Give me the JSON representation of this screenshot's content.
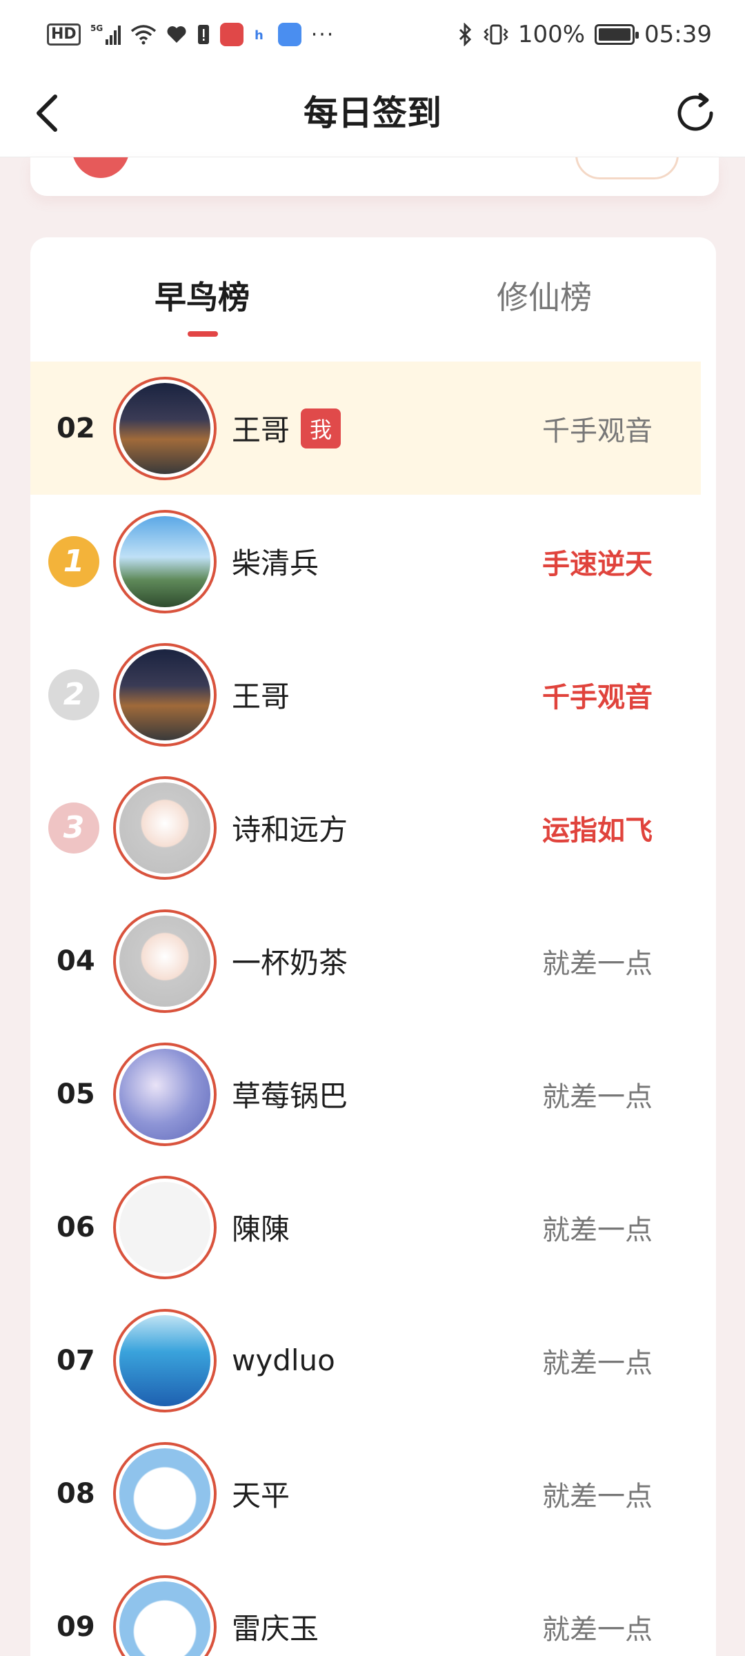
{
  "status_bar": {
    "hd": "HD",
    "network": "5G",
    "battery": "100%",
    "time": "05:39",
    "dots": "···"
  },
  "nav": {
    "title": "每日签到"
  },
  "tabs": [
    {
      "label": "早鸟榜"
    },
    {
      "label": "修仙榜"
    }
  ],
  "me_row": {
    "rank": "02",
    "name": "王哥",
    "badge": "我",
    "title": "千手观音"
  },
  "rows": [
    {
      "medal": "1",
      "name": "柴清兵",
      "title": "手速逆天"
    },
    {
      "medal": "2",
      "name": "王哥",
      "title": "千手观音"
    },
    {
      "medal": "3",
      "name": "诗和远方",
      "title": "运指如飞"
    },
    {
      "rank": "04",
      "name": "一杯奶茶",
      "title": "就差一点"
    },
    {
      "rank": "05",
      "name": "草莓锅巴",
      "title": "就差一点"
    },
    {
      "rank": "06",
      "name": "陳陳",
      "title": "就差一点"
    },
    {
      "rank": "07",
      "name": "wydluo",
      "title": "就差一点"
    },
    {
      "rank": "08",
      "name": "天平",
      "title": "就差一点"
    },
    {
      "rank": "09",
      "name": "雷庆玉",
      "title": "就差一点"
    }
  ],
  "colors": {
    "accent": "#e24545",
    "me_row_bg": "#fff7e4",
    "gold": "#f3b33a",
    "silver": "#dadada",
    "bronze": "#efc4c4"
  }
}
